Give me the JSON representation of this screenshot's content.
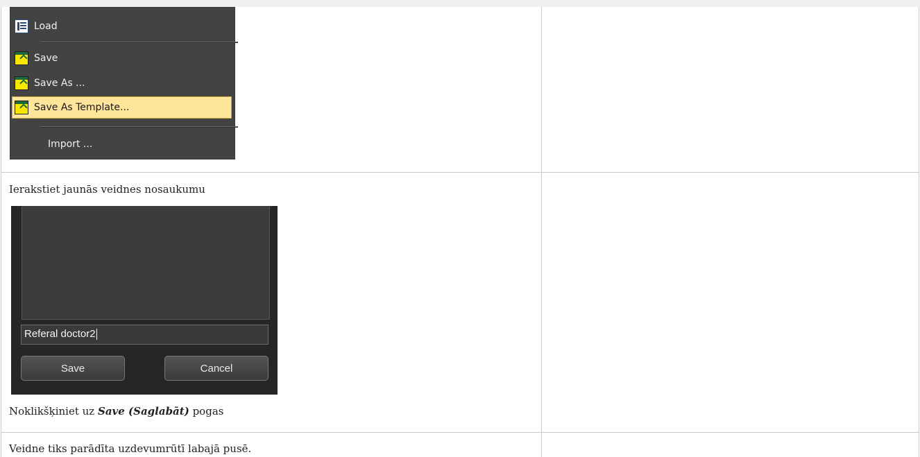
{
  "menu": {
    "items": [
      {
        "label": "Load",
        "icon": "load-icon"
      },
      {
        "label": "Save",
        "icon": "save-icon"
      },
      {
        "label": "Save As ...",
        "icon": "save-icon"
      },
      {
        "label": "Save As Template...",
        "icon": "save-icon",
        "highlighted": true
      },
      {
        "label": "Import ...",
        "icon": ""
      }
    ]
  },
  "step2": {
    "instruction": "Ierakstiet jaunās veidnes nosaukumu",
    "dialog": {
      "input_value": "Referal doctor2",
      "save_label": "Save",
      "cancel_label": "Cancel"
    },
    "click_prefix": "Noklikšķiniet uz ",
    "click_bold": "Save (Saglabāt)",
    "click_suffix": " pogas"
  },
  "step3": {
    "text": "Veidne tiks parādīta uzdevumrūtī labajā pusē."
  },
  "colors": {
    "highlight": "#ffe59a",
    "menu_bg": "#434343",
    "dialog_bg": "#262626"
  }
}
